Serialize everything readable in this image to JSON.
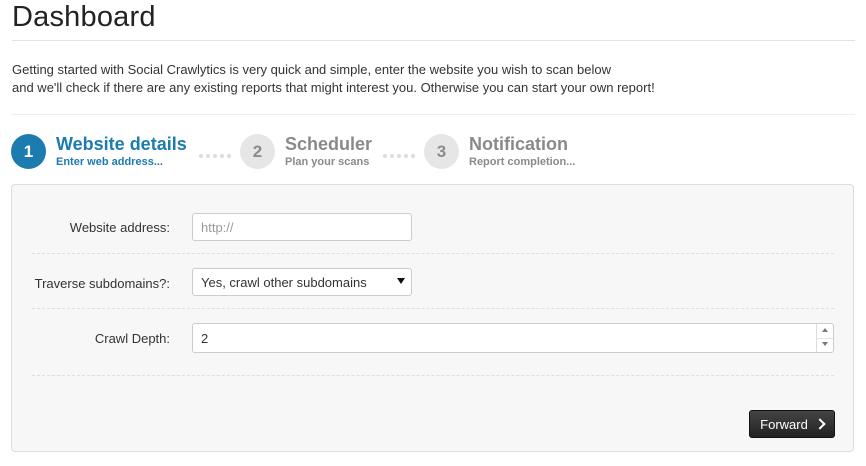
{
  "header": {
    "title": "Dashboard"
  },
  "intro": {
    "line1": "Getting started with Social Crawlytics is very quick and simple, enter the website you wish to scan below",
    "line2": "and we'll check if there are any existing reports that might interest you. Otherwise you can start your own report!"
  },
  "wizard": {
    "steps": [
      {
        "number": "1",
        "title": "Website details",
        "subtitle": "Enter web address...",
        "state": "active"
      },
      {
        "number": "2",
        "title": "Scheduler",
        "subtitle": "Plan your scans",
        "state": "inactive"
      },
      {
        "number": "3",
        "title": "Notification",
        "subtitle": "Report completion...",
        "state": "inactive"
      }
    ]
  },
  "form": {
    "website": {
      "label": "Website address:",
      "placeholder": "http://",
      "value": ""
    },
    "subdomains": {
      "label": "Traverse subdomains?:",
      "selected": "Yes, crawl other subdomains"
    },
    "depth": {
      "label": "Crawl Depth:",
      "value": "2"
    },
    "forward_label": "Forward"
  },
  "colors": {
    "accent": "#1c7cb0",
    "inactive_step": "#8a8a8a",
    "button_dark": "#2d2d2d",
    "panel_bg": "#f7f7f7"
  },
  "icons": {
    "forward": "chevron-right-icon",
    "select": "caret-down-icon",
    "stepper": "spinner-arrows-icon"
  }
}
